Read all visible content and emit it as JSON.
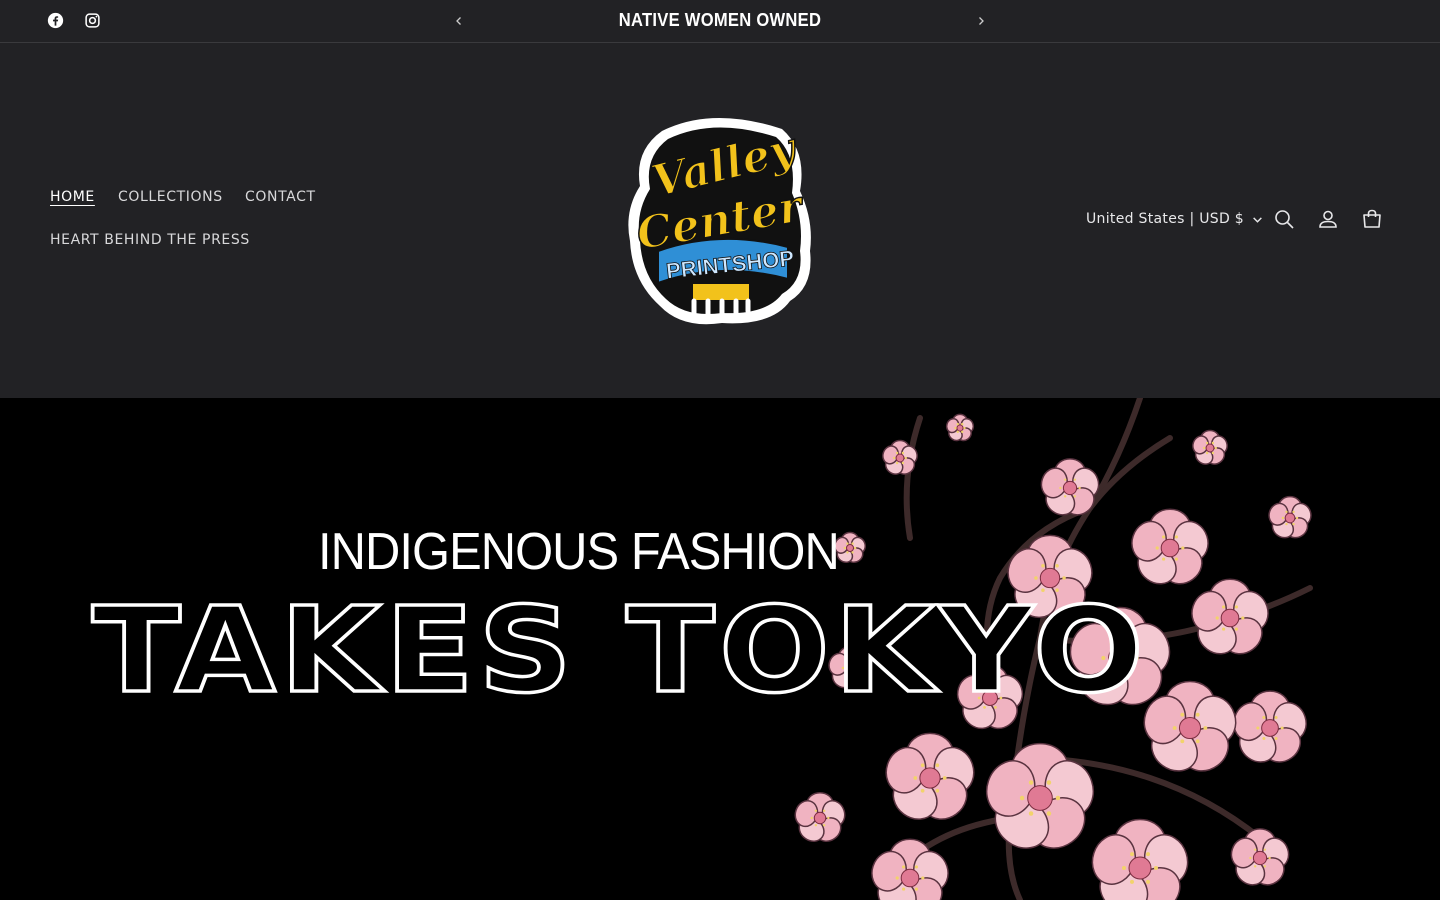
{
  "announcement": {
    "text": "NATIVE WOMEN OWNED",
    "prev_icon": "chevron-left-icon",
    "next_icon": "chevron-right-icon"
  },
  "social": {
    "facebook_icon": "facebook-icon",
    "instagram_icon": "instagram-icon"
  },
  "nav": {
    "items": [
      {
        "label": "HOME",
        "active": true
      },
      {
        "label": "COLLECTIONS",
        "active": false
      },
      {
        "label": "CONTACT",
        "active": false
      },
      {
        "label": "HEART BEHIND THE PRESS",
        "active": false
      }
    ]
  },
  "logo": {
    "line1": "Valley",
    "line2": "Center",
    "line3": "PRINTSHOP",
    "colors": {
      "yellow": "#f2c21b",
      "blue": "#2f8fd6",
      "outline": "#111111"
    }
  },
  "header": {
    "country_selector": "United States | USD $",
    "search_icon": "search-icon",
    "account_icon": "account-icon",
    "cart_icon": "cart-icon"
  },
  "hero": {
    "subtitle": "INDIGENOUS FASHION",
    "title": "TAKES TOKYO",
    "accent": "#e07a94"
  },
  "colors": {
    "header_bg": "#222225",
    "hero_bg": "#000000",
    "text": "#ffffff"
  }
}
